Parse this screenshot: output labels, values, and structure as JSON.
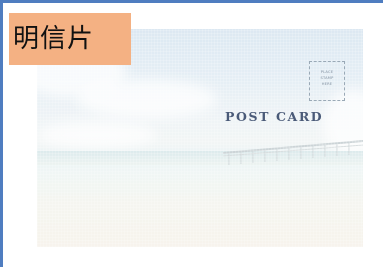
{
  "tag": {
    "label": "明信片"
  },
  "postcard": {
    "title": "POST CARD",
    "stamp_lines": [
      "PLACE",
      "STAMP",
      "HERE"
    ]
  }
}
